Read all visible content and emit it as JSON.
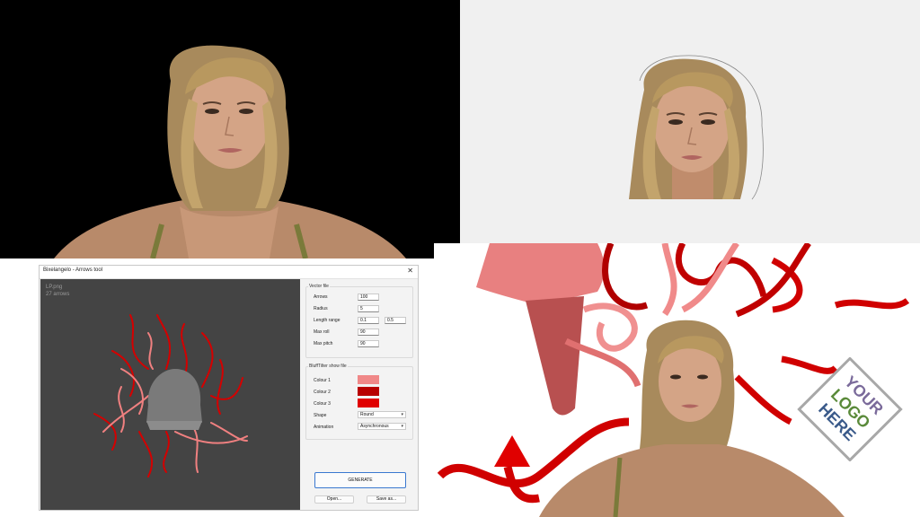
{
  "window": {
    "title": "Bixelangelo - Arrows tool",
    "close_glyph": "✕"
  },
  "preview": {
    "filename": "LP.png",
    "arrow_count": "27 arrows"
  },
  "vector_file": {
    "legend": "Vector file",
    "arrows_label": "Arrows",
    "arrows_value": "100",
    "radius_label": "Radius",
    "radius_value": "5",
    "length_range_label": "Length range",
    "length_min": "0.1",
    "length_max": "0.5",
    "max_roll_label": "Max roll",
    "max_roll_value": "90",
    "max_pitch_label": "Max pitch",
    "max_pitch_value": "90"
  },
  "bufftilter": {
    "legend": "BluffTilter show file",
    "colour1_label": "Colour 1",
    "colour2_label": "Colour 2",
    "colour3_label": "Colour 3",
    "colour1": "#f08888",
    "colour2": "#b80000",
    "colour3": "#e00000",
    "shape_label": "Shape",
    "shape_value": "Round",
    "animation_label": "Animation",
    "animation_value": "Asynchronous"
  },
  "buttons": {
    "generate": "GENERATE",
    "open": "Open...",
    "save_as": "Save as..."
  },
  "logo": {
    "line1": "YOUR",
    "line2": "LOGO",
    "line3": "HERE"
  },
  "colors": {
    "accent_blue": "#3a78d0",
    "arrow_red": "#d40000",
    "arrow_pink": "#f08080"
  }
}
